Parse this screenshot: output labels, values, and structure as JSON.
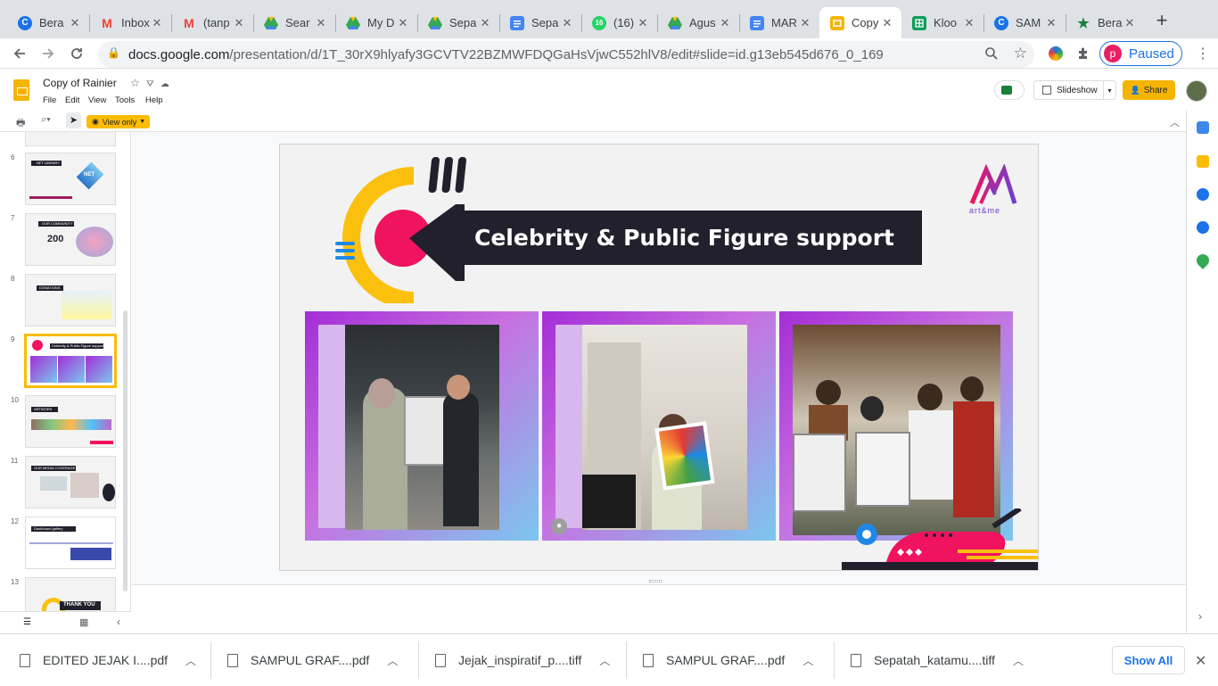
{
  "browser": {
    "tabs": [
      {
        "title": "Bera",
        "icon": "chrome-copilot-icon",
        "color": "#1a73e8"
      },
      {
        "title": "Inbox",
        "icon": "gmail-icon",
        "color": "#ea4335"
      },
      {
        "title": "(tanp",
        "icon": "gmail-icon",
        "color": "#ea4335"
      },
      {
        "title": "Sear",
        "icon": "google-drive-icon",
        "color": "#34a853"
      },
      {
        "title": "My D",
        "icon": "google-drive-icon",
        "color": "#34a853"
      },
      {
        "title": "Sepa",
        "icon": "google-drive-icon",
        "color": "#34a853"
      },
      {
        "title": "Sepa",
        "icon": "google-docs-icon",
        "color": "#4285f4"
      },
      {
        "title": "(16) \\",
        "icon": "whatsapp-badge-icon",
        "badge": "16",
        "color": "#25d366"
      },
      {
        "title": "Agus",
        "icon": "google-drive-icon",
        "color": "#34a853"
      },
      {
        "title": "MAR",
        "icon": "google-docs-icon",
        "color": "#4285f4"
      },
      {
        "title": "Copy",
        "icon": "google-slides-icon",
        "color": "#f4b400",
        "active": true
      },
      {
        "title": "Kloo",
        "icon": "google-sheets-icon",
        "color": "#0f9d58"
      },
      {
        "title": "SAM",
        "icon": "chrome-copilot-icon",
        "color": "#1a73e8"
      },
      {
        "title": "Bera",
        "icon": "star-app-icon",
        "color": "#188038"
      }
    ],
    "url_host": "docs.google.com",
    "url_path": "/presentation/d/1T_30rX9hlyafy3GCVTV22BZMWFDQGaHsVjwC552hlV8/edit#slide=id.g13eb545d676_0_169",
    "profile_initial": "p",
    "profile_status": "Paused"
  },
  "app": {
    "doc_title": "Copy of Rainier",
    "menus": [
      "File",
      "Edit",
      "View",
      "Tools",
      "Help"
    ],
    "slideshow_label": "Slideshow",
    "share_label": "Share",
    "view_only_label": "View only"
  },
  "filmstrip": {
    "slides": [
      {
        "number": "6",
        "thumb_title": "NFT LIBRARY",
        "accent": "NET"
      },
      {
        "number": "7",
        "thumb_title": "OUR COMMUNITY",
        "accent": "200"
      },
      {
        "number": "8",
        "thumb_title": "DONATIONS",
        "accent": ""
      },
      {
        "number": "9",
        "thumb_title": "Celebrity & Public Figure support",
        "accent": "",
        "selected": true
      },
      {
        "number": "10",
        "thumb_title": "ARTWORK",
        "accent": ""
      },
      {
        "number": "11",
        "thumb_title": "OUR MEDIA COVERAGE",
        "accent": ""
      },
      {
        "number": "12",
        "thumb_title": "Dashboard gallery",
        "accent": ""
      },
      {
        "number": "13",
        "thumb_title": "THANK YOU",
        "accent": ""
      }
    ]
  },
  "slide": {
    "title": "Celebrity & Public Figure support",
    "brand_text": "art&me",
    "photos": [
      {
        "caption": "Two people holding a framed portrait drawing"
      },
      {
        "caption": "Woman holding a colourful portrait painting"
      },
      {
        "caption": "Group holding two framed portrait drawings"
      }
    ],
    "colors": {
      "pink": "#f0135f",
      "yellow": "#fbc00e",
      "navy": "#21202c",
      "blue": "#1e88e5",
      "purple": "#a42ed6"
    }
  },
  "downloads": [
    {
      "name": "EDITED JEJAK I....pdf"
    },
    {
      "name": "SAMPUL GRAF....pdf"
    },
    {
      "name": "Jejak_inspiratif_p....tiff"
    },
    {
      "name": "SAMPUL GRAF....pdf"
    },
    {
      "name": "Sepatah_katamu....tiff"
    }
  ],
  "downloads_show_all": "Show All"
}
